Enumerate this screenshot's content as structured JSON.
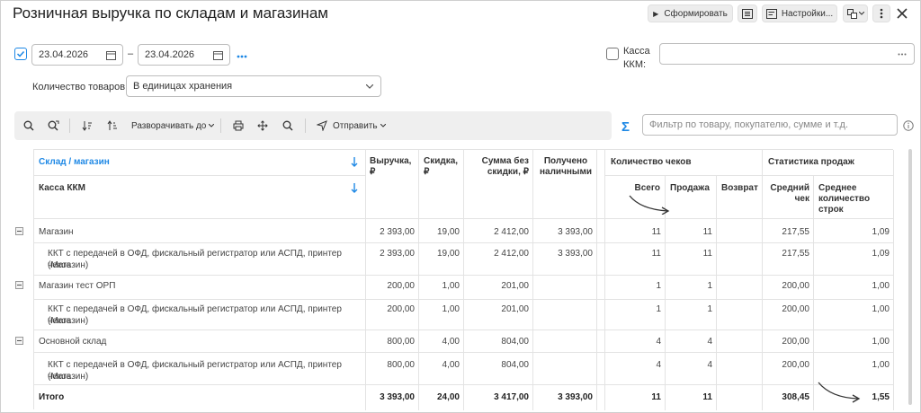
{
  "header": {
    "title": "Розничная выручка по складам и магазинам",
    "run_label": "Сформировать",
    "settings_label": "Настройки..."
  },
  "filters": {
    "date_from": "23.04.2026",
    "date_to": "23.04.2026",
    "date_separator": "–",
    "kassa_label_1": "Касса",
    "kassa_label_2": "ККМ:",
    "kassa_value": "",
    "kolvo_label": "Количество товаров:",
    "kolvo_value": "В единицах хранения"
  },
  "toolbar": {
    "expand_label": "Разворачивать до",
    "send_label": "Отправить",
    "search_placeholder": "Фильтр по товару, покупателю, сумме и т.д."
  },
  "table": {
    "headers": {
      "sklad": "Склад / магазин",
      "kassa": "Касса ККМ",
      "vyruchka_1": "Выручка,",
      "vyruchka_2": "₽",
      "skidka_1": "Скидка,",
      "skidka_2": "₽",
      "summa_1": "Сумма без",
      "summa_2": "скидки, ₽",
      "poluch_1": "Получено",
      "poluch_2": "наличными",
      "cheki_group": "Количество чеков",
      "stat_group": "Статистика продаж",
      "vsego": "Всего",
      "prodazha": "Продажа",
      "vozvrat": "Возврат",
      "sredniy_1": "Средний",
      "sredniy_2": "чек",
      "srkol_1": "Среднее",
      "srkol_2": "количество",
      "srkol_3": "строк"
    },
    "rows": [
      {
        "name": "Магазин",
        "v": "2 393,00",
        "s": "19,00",
        "b": "2 412,00",
        "p": "3 393,00",
        "vs": "11",
        "pr": "11",
        "vz": "",
        "sc": "217,55",
        "sk": "1,09"
      },
      {
        "name1": "ККТ с передачей в ОФД, фискальный регистратор или АСПД, принтер чеков",
        "name2": "(Магазин)",
        "v": "2 393,00",
        "s": "19,00",
        "b": "2 412,00",
        "p": "3 393,00",
        "vs": "11",
        "pr": "11",
        "vz": "",
        "sc": "217,55",
        "sk": "1,09"
      },
      {
        "name": "Магазин тест ОРП",
        "v": "200,00",
        "s": "1,00",
        "b": "201,00",
        "p": "",
        "vs": "1",
        "pr": "1",
        "vz": "",
        "sc": "200,00",
        "sk": "1,00"
      },
      {
        "name1": "ККТ с передачей в ОФД, фискальный регистратор или АСПД, принтер чеков",
        "name2": "(Магазин)",
        "v": "200,00",
        "s": "1,00",
        "b": "201,00",
        "p": "",
        "vs": "1",
        "pr": "1",
        "vz": "",
        "sc": "200,00",
        "sk": "1,00"
      },
      {
        "name": "Основной склад",
        "v": "800,00",
        "s": "4,00",
        "b": "804,00",
        "p": "",
        "vs": "4",
        "pr": "4",
        "vz": "",
        "sc": "200,00",
        "sk": "1,00"
      },
      {
        "name1": "ККТ с передачей в ОФД, фискальный регистратор или АСПД, принтер чеков",
        "name2": "(Магазин)",
        "v": "800,00",
        "s": "4,00",
        "b": "804,00",
        "p": "",
        "vs": "4",
        "pr": "4",
        "vz": "",
        "sc": "200,00",
        "sk": "1,00"
      }
    ],
    "total": {
      "name": "Итого",
      "v": "3 393,00",
      "s": "24,00",
      "b": "3 417,00",
      "p": "3 393,00",
      "vs": "11",
      "pr": "11",
      "vz": "",
      "sc": "308,45",
      "sk": "1,55"
    }
  },
  "colors": {
    "accent": "#1e88e5",
    "link": "#1e88e5"
  }
}
